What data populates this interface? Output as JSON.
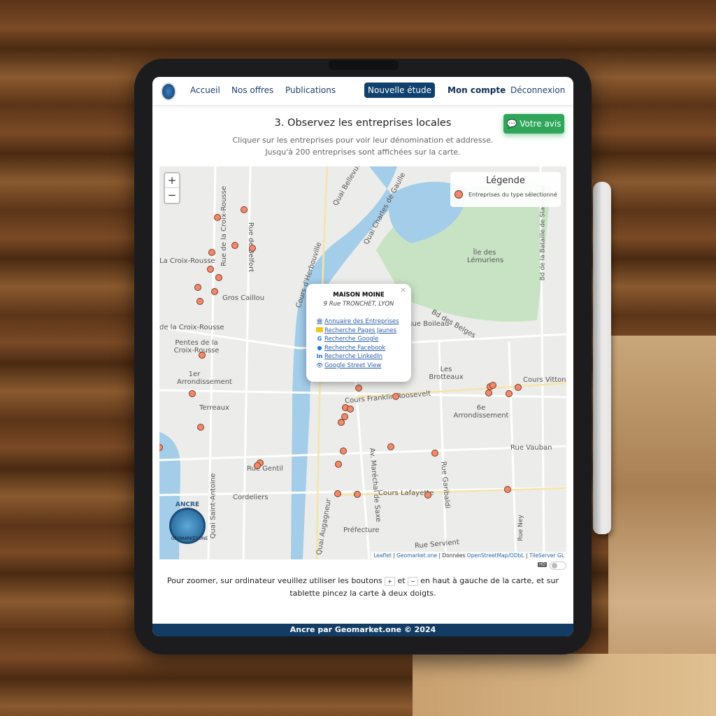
{
  "nav": {
    "accueil": "Accueil",
    "offres": "Nos offres",
    "publications": "Publications",
    "nouvelle_etude": "Nouvelle étude",
    "compte": "Mon compte",
    "deconnexion": "Déconnexion"
  },
  "page": {
    "title": "3. Observez les entreprises locales",
    "subtitle1": "Cliquer sur les entreprises pour voir leur dénomination et addresse.",
    "subtitle2": "Jusqu'à 200 entreprises sont affichées sur la carte.",
    "feedback": "Votre avis"
  },
  "map": {
    "zoom_in": "+",
    "zoom_out": "−",
    "legend": {
      "title": "Légende",
      "item": "Entreprises du type sélectionné",
      "marker_color": "#f08a6a"
    },
    "popup": {
      "close": "×",
      "name": "MAISON MOINE",
      "address": "9 Rue TRONCHET, LYON",
      "links": [
        "Annuaire des Entreprises",
        "Recherche Pages Jaunes",
        "Recherche Google",
        "Recherche Facebook",
        "Recherche LinkedIn",
        "Google Street View"
      ]
    },
    "labels": [
      "Quai Bellevue",
      "Quai Charles de Gaulle",
      "Cours d'Herbouville",
      "Rue de la Croix-Rousse",
      "Rue de Belfort",
      "La Croix-Rousse",
      "Gros Caillou",
      "de la Croix-Rousse",
      "Pentes de la Croix-Rousse",
      "1er Arrondissement",
      "Terreaux",
      "Rue Gentil",
      "Cordeliers",
      "Quai Saint-Antoine",
      "Île des Lémuriens",
      "Bd des Belges",
      "Rue Boileau",
      "Les Brotteaux",
      "Cours Franklin Roosevelt",
      "6e Arrondissement",
      "Cours Vitton",
      "Rue Vauban",
      "Av. Maréchal de Saxe",
      "Rue Garibaldi",
      "Cours Lafayette",
      "Préfecture",
      "Quai Augagneur",
      "Rue Servient",
      "Bd de la Bataille de Stalingrad",
      "Rue Ney"
    ],
    "logo_text": "ANCRE",
    "logo_sub": "GEOMARKET.ONE",
    "attribution": {
      "leaflet": "Leaflet",
      "geomarket": "Geomarket.one",
      "donnees": "Données",
      "osm": "OpenStreetMap/ODbL",
      "tileserver": "TileServer GL"
    },
    "hd": "HD"
  },
  "help": {
    "part1": "Pour zoomer, sur ordinateur veuillez utiliser les boutons",
    "plus": "+",
    "et": "et",
    "minus": "−",
    "part2": "en haut à gauche de la carte, et sur tablette pincez la carte à deux doigts."
  },
  "footer": "Ancre par Geomarket.one © 2024",
  "colors": {
    "brand": "#0f416e",
    "feedback": "#2fa65a",
    "marker": "#f08a6a"
  }
}
